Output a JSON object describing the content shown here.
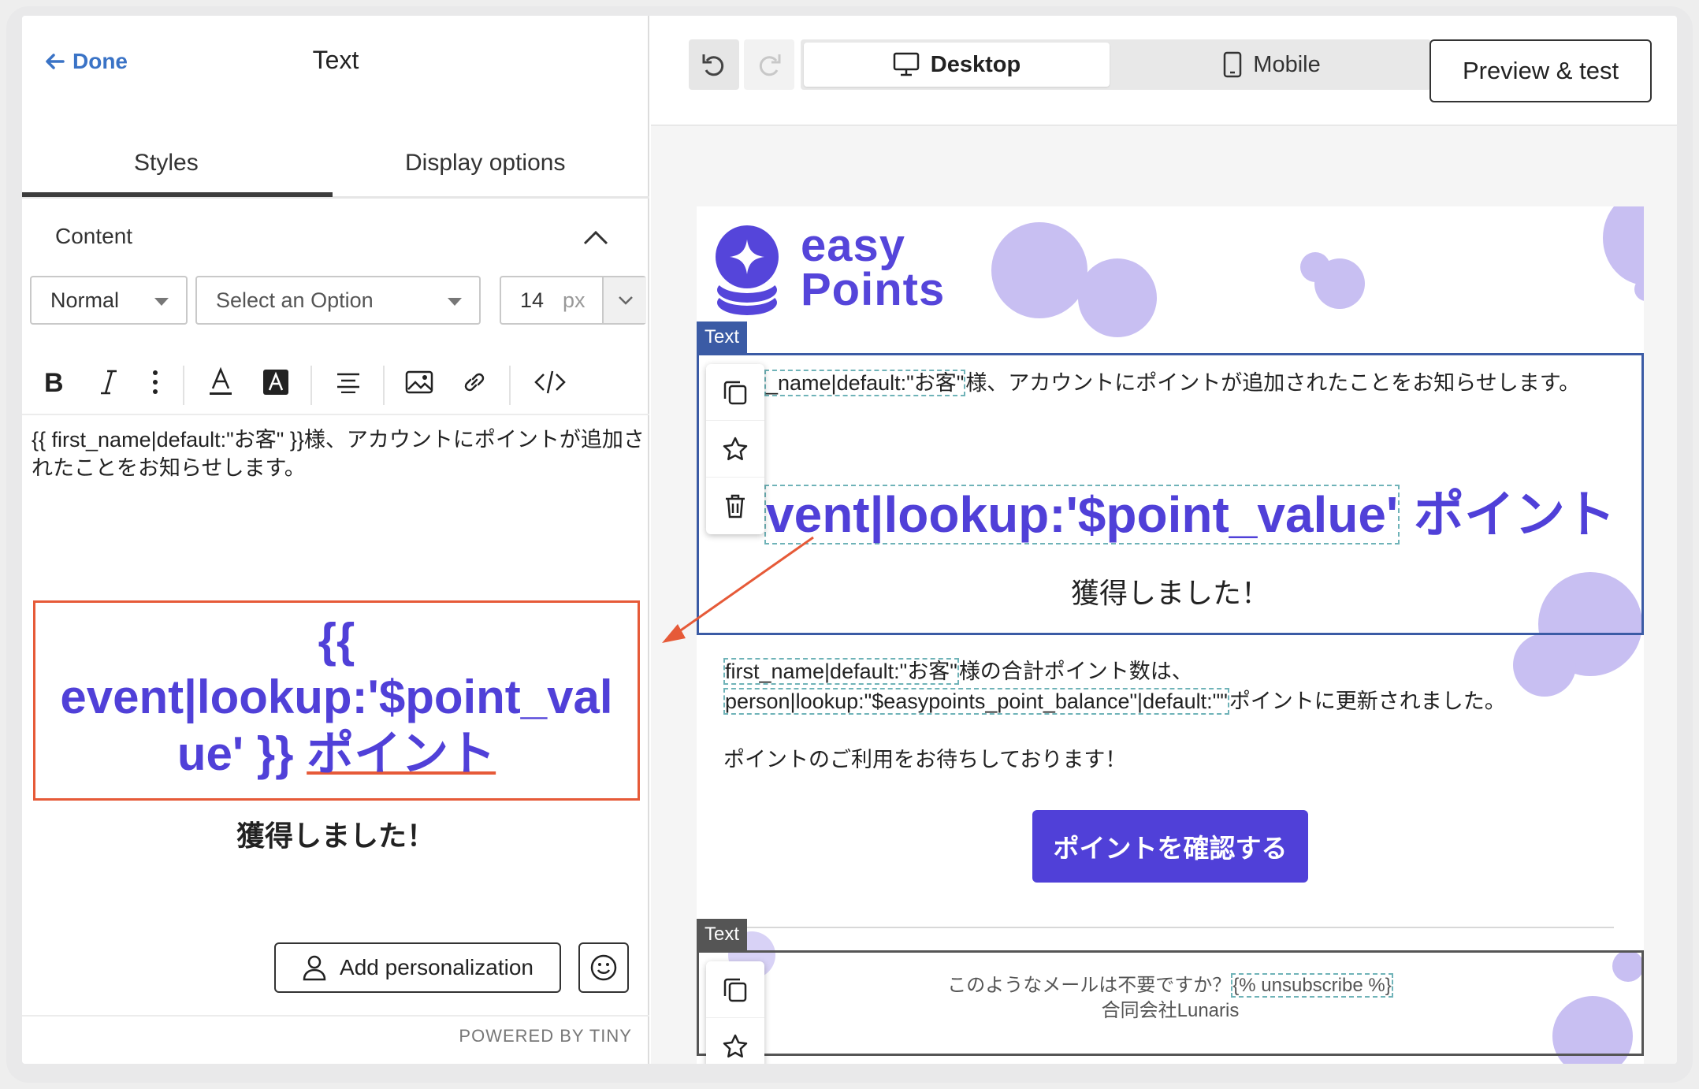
{
  "left_panel": {
    "done_label": "Done",
    "title": "Text",
    "tabs": [
      {
        "label": "Styles",
        "active": true
      },
      {
        "label": "Display options",
        "active": false
      }
    ],
    "section_title": "Content",
    "format_select": "Normal",
    "font_select_placeholder": "Select an Option",
    "font_size": "14",
    "font_unit": "px",
    "editor_line1": "{{ first_name|default:\"お客\" }}様、アカウントにポイントが追加されたことをお知らせします。",
    "editor_big_line1": "{{",
    "editor_big_line2": "event|lookup:'$point_val",
    "editor_big_line3a": "ue' }}",
    "editor_big_line3b": "ポイント",
    "editor_earned": "獲得しました！",
    "add_personalization": "Add personalization",
    "powered_by": "POWERED BY TINY"
  },
  "right_panel": {
    "device_desktop": "Desktop",
    "device_mobile": "Mobile",
    "preview_button": "Preview & test",
    "logo_line1": "easy",
    "logo_line2": "Points",
    "block_tag": "Text",
    "greeting_token": "_name|default:\"お客\"",
    "greeting_rest": "様、アカウントにポイントが追加されたことをお知らせします。",
    "points_token": "vent|lookup:'$point_value'",
    "points_suffix": "ポイント",
    "earned": "獲得しました！",
    "total_token": "first_name|default:\"お客\"",
    "total_rest": "様の合計ポイント数は、",
    "balance_token": "person|lookup:\"$easypoints_point_balance\"|default:\"\"",
    "balance_rest": "ポイントに更新されました。",
    "looking_forward": "ポイントのご利用をお待ちしております！",
    "cta_button": "ポイントを確認する",
    "footer_question": "このようなメールは不要ですか？",
    "footer_unsub": "{% unsubscribe %}",
    "footer_company": "合同会社Lunaris"
  },
  "colors": {
    "accent": "#5040d8",
    "annotation": "#e65a38",
    "selection": "#3b5ba5"
  }
}
